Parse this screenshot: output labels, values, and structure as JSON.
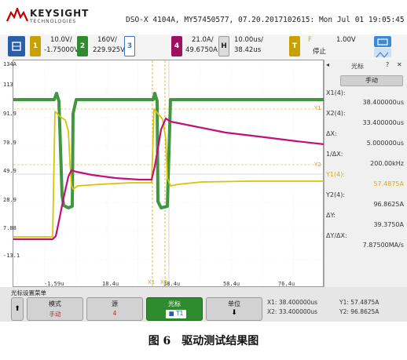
{
  "header": {
    "brand": "KEYSIGHT",
    "brand_sub": "TECHNOLOGIES",
    "model_line": "DSO-X 4104A, MY57450577, 07.20.2017102615: Mon Jul 01 19:05:45 2019"
  },
  "channels": [
    {
      "num": "1",
      "scale": "10.0V/",
      "offset": "-1.75000V",
      "color": "#c8a000"
    },
    {
      "num": "2",
      "scale": "160V/",
      "offset": "229.925V",
      "color": "#2e8b2e"
    },
    {
      "num": "3",
      "scale": "",
      "offset": "",
      "color": "#3a74c4"
    },
    {
      "num": "4",
      "scale": "21.0A/",
      "offset": "49.6750A",
      "color": "#a01060"
    }
  ],
  "timebase": {
    "mode": "H",
    "scale": "10.00us/",
    "delay": "38.42us"
  },
  "trigger": {
    "mode": "T",
    "source": "F",
    "level": "1.00V",
    "state": "停止"
  },
  "plot": {
    "y_labels": [
      "134A",
      "113",
      "91.9",
      "70.9",
      "49.9",
      "28.9",
      "7.88",
      "-13.1"
    ],
    "x_labels": [
      "-1.59u",
      "18.4u",
      "38.4u",
      "58.4u",
      "76.4u"
    ],
    "cursor_labels": [
      "Y1",
      "X1",
      "Y2",
      "X2"
    ]
  },
  "cursor_panel": {
    "title": "光标",
    "mode_label": "手动",
    "rows": [
      {
        "label": "X1(4):",
        "value": "38.400000us"
      },
      {
        "label": "X2(4):",
        "value": "33.400000us"
      },
      {
        "label": "ΔX:",
        "value": "5.000000us"
      },
      {
        "label": "1/ΔX:",
        "value": "200.00kHz"
      },
      {
        "label": "Y1(4):",
        "value": "57.4875A"
      },
      {
        "label": "Y2(4):",
        "value": "96.8625A"
      },
      {
        "label": "ΔY:",
        "value": "39.3750A"
      },
      {
        "label": "ΔY/ΔX:",
        "value": "7.87500MA/s"
      }
    ]
  },
  "softkeys": {
    "title": "光标设置菜单",
    "keys": [
      {
        "l1": "模式",
        "l2": "手动"
      },
      {
        "l1": "源",
        "l2": "4"
      },
      {
        "l1": "光标",
        "l2": "T1"
      },
      {
        "l1": "单位",
        "l2": ""
      }
    ],
    "readout": {
      "x1": "X1: 38.400000us",
      "x2": "X2: 33.400000us",
      "y1": "Y1: 57.4875A",
      "y2": "Y2: 96.8625A"
    }
  },
  "caption": "图 6　驱动测试结果图"
}
